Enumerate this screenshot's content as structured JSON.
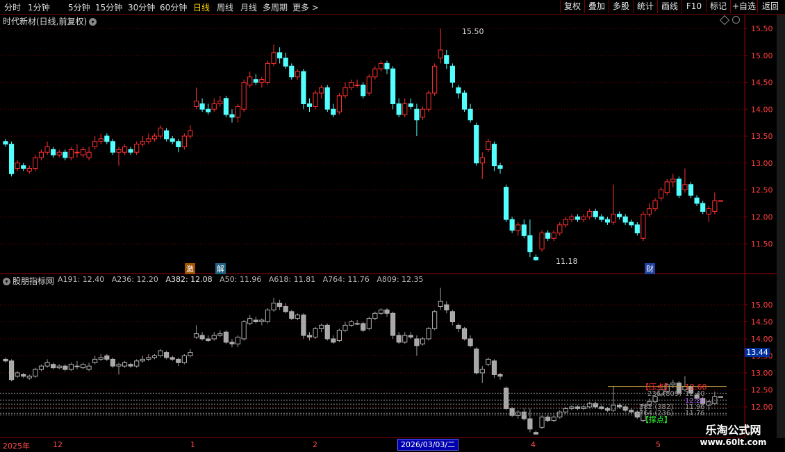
{
  "toolbar": {
    "periods": [
      "分时",
      "1分钟",
      "5分钟",
      "15分钟",
      "30分钟",
      "60分钟",
      "日线",
      "周线",
      "月线",
      "多周期",
      "更多"
    ],
    "active_period": "日线",
    "buttons": [
      "复权",
      "叠加",
      "多股",
      "统计",
      "画线",
      "F10",
      "标记",
      "+自选",
      "返回"
    ]
  },
  "main_panel": {
    "title": "时代新材(日线,前复权)"
  },
  "sub_panel": {
    "title": "股朋指标网",
    "legend": [
      {
        "label": "A191: 12.40",
        "color": "#8c8c8c"
      },
      {
        "label": "A236: 12.20",
        "color": "#8c8c8c"
      },
      {
        "label": "A382: 12.08",
        "color": "#dcdcdc"
      },
      {
        "label": "A50: 11.96",
        "color": "#8c8c8c"
      },
      {
        "label": "A618: 11.81",
        "color": "#8c8c8c"
      },
      {
        "label": "A764: 11.76",
        "color": "#8c8c8c"
      },
      {
        "label": "A809: 12.35",
        "color": "#8c8c8c"
      }
    ]
  },
  "events": {
    "e1": "激",
    "e2": "解",
    "e3": "财"
  },
  "price_tag": "13.44",
  "dates": {
    "year": "2025年",
    "m12": "12",
    "m1": "1",
    "m2": "2",
    "m4": "4",
    "m5": "5",
    "cursor": "2026/03/03/二"
  },
  "overlay": {
    "pressure_label": "【压点】",
    "pressure_value": "12.60",
    "support_label": "【撑点】",
    "lines": [
      {
        "text": "236 (809)",
        "value": "12.40"
      },
      {
        "text": "",
        "value": "12.20"
      },
      {
        "text": "382 (382)",
        "value": "11.96"
      },
      {
        "text": "764 (236)",
        "value": "11.76"
      }
    ]
  },
  "watermark": {
    "line1": "乐淘公式网",
    "line2": "www.60lt.com"
  },
  "colors": {
    "up": "#ff3030",
    "down": "#54ffff",
    "grid": "#800000",
    "sub_candle": "#b4b4b4"
  },
  "chart_data": [
    {
      "type": "candlestick",
      "title": "时代新材(日线,前复权)",
      "y_ticks": [
        15.5,
        15.0,
        14.5,
        14.0,
        13.5,
        13.0,
        12.5,
        12.0,
        11.5
      ],
      "ylim": [
        11.0,
        15.75
      ],
      "annotations": [
        {
          "text": "15.50",
          "y": 15.5
        },
        {
          "text": "11.18",
          "y": 11.18
        }
      ],
      "candles": [
        [
          13.4,
          13.35,
          13.45,
          13.3
        ],
        [
          13.35,
          12.8,
          13.4,
          12.75
        ],
        [
          12.9,
          13.0,
          13.05,
          12.85
        ],
        [
          12.95,
          12.9,
          13.0,
          12.85
        ],
        [
          12.85,
          12.9,
          12.95,
          12.8
        ],
        [
          12.9,
          13.1,
          13.15,
          12.85
        ],
        [
          13.1,
          13.2,
          13.25,
          13.05
        ],
        [
          13.2,
          13.3,
          13.4,
          13.15
        ],
        [
          13.25,
          13.15,
          13.3,
          13.1
        ],
        [
          13.15,
          13.2,
          13.25,
          13.1
        ],
        [
          13.2,
          13.1,
          13.25,
          13.05
        ],
        [
          13.1,
          13.25,
          13.3,
          13.05
        ],
        [
          13.2,
          13.2,
          13.35,
          13.1
        ],
        [
          13.15,
          13.25,
          13.3,
          13.1
        ],
        [
          13.1,
          13.2,
          13.3,
          13.05
        ],
        [
          13.3,
          13.4,
          13.5,
          13.25
        ],
        [
          13.4,
          13.45,
          13.55,
          13.35
        ],
        [
          13.5,
          13.4,
          13.55,
          13.35
        ],
        [
          13.4,
          13.2,
          13.45,
          13.15
        ],
        [
          13.2,
          13.25,
          13.3,
          12.95
        ],
        [
          13.2,
          13.3,
          13.35,
          13.15
        ],
        [
          13.25,
          13.2,
          13.3,
          13.15
        ],
        [
          13.2,
          13.35,
          13.4,
          13.15
        ],
        [
          13.35,
          13.4,
          13.5,
          13.3
        ],
        [
          13.4,
          13.45,
          13.55,
          13.35
        ],
        [
          13.45,
          13.5,
          13.55,
          13.4
        ],
        [
          13.5,
          13.65,
          13.7,
          13.45
        ],
        [
          13.6,
          13.45,
          13.65,
          13.4
        ],
        [
          13.45,
          13.4,
          13.5,
          13.35
        ],
        [
          13.4,
          13.3,
          13.45,
          13.2
        ],
        [
          13.3,
          13.5,
          13.55,
          13.25
        ],
        [
          13.5,
          13.6,
          13.7,
          13.45
        ],
        [
          14.05,
          14.15,
          14.4,
          14.0
        ],
        [
          14.1,
          14.0,
          14.2,
          13.95
        ],
        [
          14.0,
          13.95,
          14.1,
          13.9
        ],
        [
          14.0,
          14.1,
          14.2,
          13.95
        ],
        [
          14.1,
          14.15,
          14.25,
          14.05
        ],
        [
          14.2,
          13.9,
          14.25,
          13.85
        ],
        [
          13.9,
          13.85,
          14.0,
          13.75
        ],
        [
          13.85,
          14.05,
          14.1,
          13.75
        ],
        [
          14.0,
          14.5,
          14.55,
          13.95
        ],
        [
          14.45,
          14.6,
          14.7,
          14.4
        ],
        [
          14.55,
          14.5,
          14.65,
          14.45
        ],
        [
          14.5,
          14.55,
          14.6,
          14.4
        ],
        [
          14.5,
          14.85,
          14.9,
          14.45
        ],
        [
          14.85,
          15.05,
          15.2,
          14.8
        ],
        [
          15.05,
          14.95,
          15.15,
          14.85
        ],
        [
          14.95,
          14.8,
          15.05,
          14.75
        ],
        [
          14.8,
          14.6,
          14.85,
          14.55
        ],
        [
          14.6,
          14.7,
          14.75,
          14.55
        ],
        [
          14.7,
          14.1,
          14.75,
          14.0
        ],
        [
          14.1,
          14.05,
          14.2,
          13.95
        ],
        [
          14.05,
          14.3,
          14.35,
          14.0
        ],
        [
          14.3,
          14.4,
          14.45,
          14.2
        ],
        [
          14.4,
          14.0,
          14.45,
          13.95
        ],
        [
          14.0,
          13.9,
          14.1,
          13.85
        ],
        [
          13.95,
          14.25,
          14.3,
          13.9
        ],
        [
          14.25,
          14.4,
          14.5,
          14.2
        ],
        [
          14.4,
          14.5,
          14.55,
          14.35
        ],
        [
          14.45,
          14.45,
          14.55,
          14.4
        ],
        [
          14.45,
          14.25,
          14.5,
          14.2
        ],
        [
          14.3,
          14.6,
          14.65,
          14.25
        ],
        [
          14.6,
          14.75,
          14.8,
          14.55
        ],
        [
          14.75,
          14.85,
          14.9,
          14.7
        ],
        [
          14.85,
          14.75,
          14.9,
          14.65
        ],
        [
          14.75,
          14.1,
          14.8,
          14.0
        ],
        [
          14.1,
          13.9,
          14.2,
          13.85
        ],
        [
          13.9,
          14.1,
          14.2,
          13.85
        ],
        [
          14.1,
          14.05,
          14.2,
          14.0
        ],
        [
          14.0,
          13.8,
          14.1,
          13.5
        ],
        [
          13.85,
          14.0,
          14.05,
          13.8
        ],
        [
          14.0,
          14.3,
          14.35,
          13.95
        ],
        [
          14.3,
          14.8,
          14.85,
          14.25
        ],
        [
          14.95,
          15.1,
          15.5,
          14.85
        ],
        [
          15.0,
          14.85,
          15.1,
          14.75
        ],
        [
          14.8,
          14.5,
          14.85,
          14.4
        ],
        [
          14.4,
          14.3,
          14.45,
          14.2
        ],
        [
          14.3,
          14.0,
          14.35,
          13.95
        ],
        [
          14.0,
          13.8,
          14.1,
          13.75
        ],
        [
          13.7,
          13.0,
          13.75,
          12.95
        ],
        [
          13.0,
          13.1,
          13.2,
          12.7
        ],
        [
          13.25,
          13.4,
          13.45,
          13.2
        ],
        [
          13.35,
          12.95,
          13.4,
          12.85
        ],
        [
          12.95,
          12.9,
          13.0,
          12.8
        ],
        [
          12.55,
          11.95,
          12.6,
          11.9
        ],
        [
          11.95,
          11.75,
          12.0,
          11.7
        ],
        [
          11.75,
          11.85,
          11.9,
          11.65
        ],
        [
          11.85,
          11.65,
          11.95,
          11.6
        ],
        [
          11.65,
          11.35,
          11.95,
          11.25
        ],
        [
          11.25,
          11.2,
          11.3,
          11.18
        ],
        [
          11.4,
          11.7,
          11.75,
          11.35
        ],
        [
          11.7,
          11.6,
          11.75,
          11.55
        ],
        [
          11.6,
          11.7,
          11.75,
          11.55
        ],
        [
          11.7,
          11.85,
          11.9,
          11.65
        ],
        [
          11.85,
          11.95,
          12.0,
          11.8
        ],
        [
          11.95,
          12.0,
          12.05,
          11.9
        ],
        [
          12.0,
          11.95,
          12.05,
          11.9
        ],
        [
          11.95,
          12.0,
          12.05,
          11.9
        ],
        [
          12.0,
          12.1,
          12.15,
          11.95
        ],
        [
          12.1,
          12.0,
          12.15,
          11.95
        ],
        [
          12.0,
          11.95,
          12.05,
          11.9
        ],
        [
          11.95,
          11.9,
          12.0,
          11.85
        ],
        [
          11.9,
          12.05,
          12.6,
          11.85
        ],
        [
          12.05,
          12.0,
          12.1,
          11.95
        ],
        [
          12.0,
          11.9,
          12.05,
          11.85
        ],
        [
          11.9,
          11.85,
          11.95,
          11.8
        ],
        [
          11.85,
          11.7,
          11.9,
          11.65
        ],
        [
          11.6,
          12.05,
          12.1,
          11.55
        ],
        [
          12.05,
          12.15,
          12.25,
          12.0
        ],
        [
          12.15,
          12.3,
          12.35,
          12.1
        ],
        [
          12.35,
          12.5,
          12.55,
          12.3
        ],
        [
          12.45,
          12.65,
          12.7,
          12.4
        ],
        [
          12.65,
          12.7,
          12.8,
          12.55
        ],
        [
          12.7,
          12.4,
          12.75,
          12.35
        ],
        [
          12.5,
          12.6,
          12.9,
          12.45
        ],
        [
          12.6,
          12.4,
          12.65,
          12.35
        ],
        [
          12.35,
          12.25,
          12.4,
          12.2
        ],
        [
          12.25,
          12.1,
          12.3,
          12.05
        ],
        [
          12.05,
          12.15,
          12.2,
          11.9
        ],
        [
          12.1,
          12.3,
          12.45,
          12.05
        ],
        [
          12.3,
          12.3,
          12.3,
          12.3
        ]
      ]
    },
    {
      "type": "candlestick",
      "title": "股朋指标网",
      "y_ticks": [
        15.0,
        14.5,
        14.0,
        13.5,
        13.0,
        12.5,
        12.0
      ],
      "ylim": [
        11.2,
        15.75
      ],
      "levels": [
        12.6,
        12.4,
        12.2,
        12.08,
        11.96,
        11.81,
        11.76
      ]
    }
  ]
}
